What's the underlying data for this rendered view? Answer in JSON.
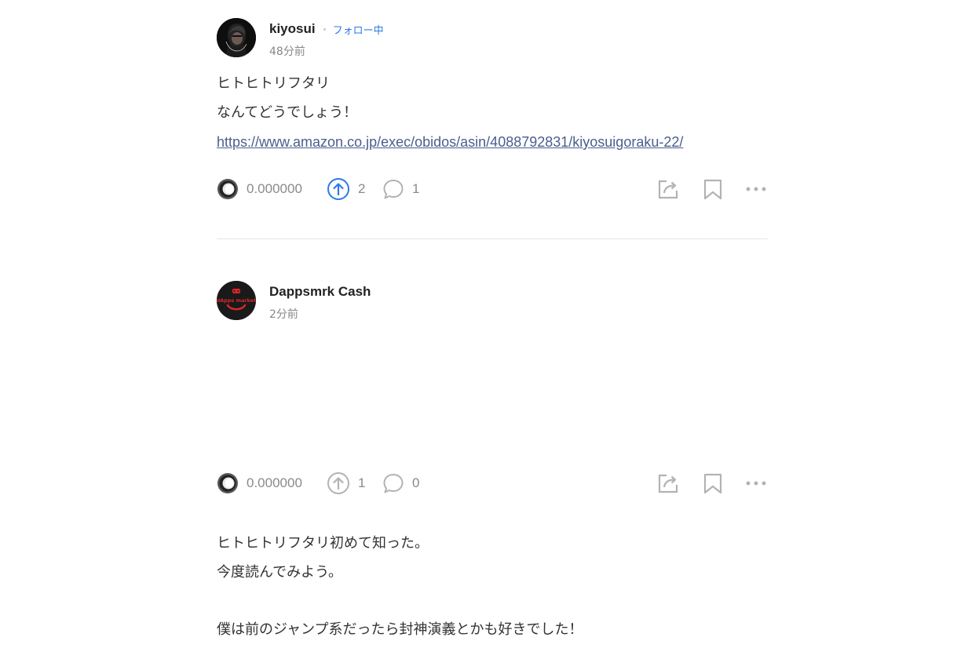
{
  "posts": [
    {
      "user": {
        "name": "kiyosui",
        "follow_status": "フォロー中",
        "avatar_icon": "dark-portrait-avatar"
      },
      "time": "48分前",
      "body_lines": [
        "ヒトヒトリフタリ",
        "なんてどうでしょう！"
      ],
      "link": "https://www.amazon.co.jp/exec/obidos/asin/4088792831/kiyosuigoraku-22/",
      "token_amount": "0.000000",
      "upvotes": "2",
      "upvoted": true,
      "comments": "1"
    },
    {
      "user": {
        "name": "Dappsmrk Cash",
        "avatar_label": "dApps market",
        "avatar_icon": "dapps-market-logo"
      },
      "time": "2分前",
      "body_lines": [
        "ヒトヒトリフタリ初めて知った。",
        "今度読んでみよう。",
        "",
        "僕は前のジャンプ系だったら封神演義とかも好きでした！"
      ],
      "token_amount": "0.000000",
      "upvotes": "1",
      "upvoted": false,
      "comments": "0"
    }
  ],
  "colors": {
    "upvoted": "#2d7be5",
    "icon_gray": "#b3b3b3",
    "link": "#4a5e8c",
    "follow": "#2d7be5",
    "divider": "#e6e6e6"
  }
}
